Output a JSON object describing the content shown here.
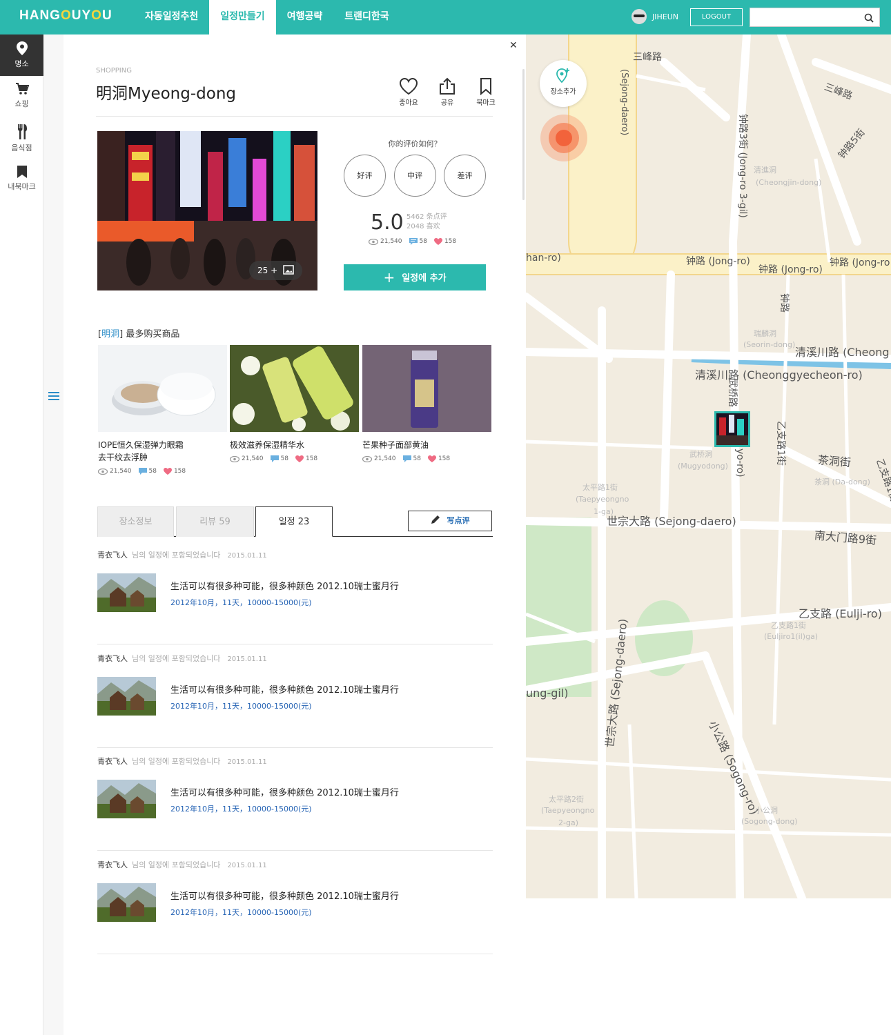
{
  "header": {
    "logo": {
      "part1": "HANG",
      "o1": "O",
      "part2": "U",
      "y": "Y",
      "part3": "O",
      "u": "U"
    },
    "nav": [
      "자동일정추천",
      "일정만들기",
      "여행공략",
      "트랜디한국"
    ],
    "user": "JIHEUN",
    "logout": "LOGOUT",
    "search_placeholder": ""
  },
  "sidebar": {
    "items": [
      {
        "label": "명소",
        "icon": "location-pin-icon"
      },
      {
        "label": "쇼핑",
        "icon": "cart-icon"
      },
      {
        "label": "음식점",
        "icon": "fork-icon"
      },
      {
        "label": "내북마크",
        "icon": "bookmark-icon"
      }
    ]
  },
  "place": {
    "category": "SHOPPING",
    "title": "明洞Myeong-dong",
    "actions": [
      "좋아요",
      "공유",
      "북마크"
    ],
    "photo_count": "25 +",
    "rating_question": "你的评价如何？",
    "rating_options": [
      "好评",
      "中评",
      "差评"
    ],
    "score": "5.0",
    "review_count": "5462 条点评",
    "like_count": "2048 喜欢",
    "views": "21,540",
    "comments": "58",
    "likes": "158",
    "add_button": "일정에 추가"
  },
  "best": {
    "open": "[",
    "keyword": "明洞",
    "close": "]",
    "label": "最多购买商品",
    "products": [
      {
        "name1": "IOPE恒久保湿弹力眼霜",
        "name2": "去干纹去浮肿",
        "views": "21,540",
        "comments": "58",
        "likes": "158"
      },
      {
        "name1": "极效滋养保湿精华水",
        "name2": "",
        "views": "21,540",
        "comments": "58",
        "likes": "158"
      },
      {
        "name1": "芒果种子面部黄油",
        "name2": "",
        "views": "21,540",
        "comments": "58",
        "likes": "158"
      }
    ]
  },
  "tabs": [
    {
      "label": "장소정보",
      "count": ""
    },
    {
      "label": "리뷰",
      "count": "59"
    },
    {
      "label": "일정",
      "count": "23"
    }
  ],
  "write_button": "写点评",
  "schedules": [
    {
      "user": "青衣飞人",
      "text": "님의 일정에 포함되었습니다",
      "date": "2015.01.11",
      "title": "生活可以有很多种可能，很多种颜色 2012.10瑞士蜜月行",
      "meta": "2012年10月，11天，10000-15000(元)"
    },
    {
      "user": "青衣飞人",
      "text": "님의 일정에 포함되었습니다",
      "date": "2015.01.11",
      "title": "生活可以有很多种可能，很多种颜色 2012.10瑞士蜜月行",
      "meta": "2012年10月，11天，10000-15000(元)"
    },
    {
      "user": "青衣飞人",
      "text": "님의 일정에 포함되었습니다",
      "date": "2015.01.11",
      "title": "生活可以有很多种可能，很多种颜色 2012.10瑞士蜜月行",
      "meta": "2012年10月，11天，10000-15000(元)"
    },
    {
      "user": "青衣飞人",
      "text": "님의 일정에 포함되었습니다",
      "date": "2015.01.11",
      "title": "生活可以有很多种可能，很多种颜色 2012.10瑞士蜜月行",
      "meta": "2012年10月，11天，10000-15000(元)"
    }
  ],
  "map": {
    "add_place": "장소추가",
    "labels": {
      "sejong_top": "(Sejong-daero)",
      "samil": "三峰路",
      "samil2": "三峰路",
      "jongno5": "钟路5街",
      "jongno3": "钟路3街 (Jong-ro 3-gil)",
      "cheongjin": "清進洞",
      "cheongjin_en": "(Cheongjin-dong)",
      "jongro1": "钟路 (Jong-ro)",
      "jongro2": "钟路 (Jong-ro)",
      "jongro3": "钟路 (Jong-ro",
      "han": "han-ro)",
      "jongro_v": "钟路",
      "seorin": "瑞麟洞",
      "seorin_en": "(Seorin-dong)",
      "cheonggye1": "清溪川路 (Cheong",
      "cheonggye2": "清溪川路 (Cheonggyecheon-ro)",
      "mugyo": "武桥路",
      "mugyo_ro": "yo-ro)",
      "euljiro1ga": "乙支路1街",
      "mugyodong": "武桥洞",
      "mugyodong_en": "(Mugyodong)",
      "dadong": "茶洞街",
      "dadong_sm": "茶洞 (Da-dong)",
      "eulji_v": "乙支路1街",
      "taepyeong": "太平路1街",
      "taepyeong_en": "(Taepyeongno",
      "taepyeong_en2": "1-ga)",
      "sejong_mid": "世宗大路 (Sejong-daero)",
      "namdaemun": "南大门路9街",
      "euljiro": "乙支路 (Eulji-ro)",
      "euljiro1ga_sm": "乙支路1街",
      "euljiro1ga_en": "(Euljiro1(il)ga)",
      "sejong_low": "世宗大路 (Sejong-daero)",
      "gil": "ung-gil)",
      "sogong": "小公路 (Sogong-ro)",
      "taepyeong2": "太平路2街",
      "taepyeong2_en": "(Taepyeongno",
      "taepyeong2_en2": "2-ga)",
      "sogongdong": "小公洞",
      "sogongdong_en": "(Sogong-dong)"
    }
  }
}
